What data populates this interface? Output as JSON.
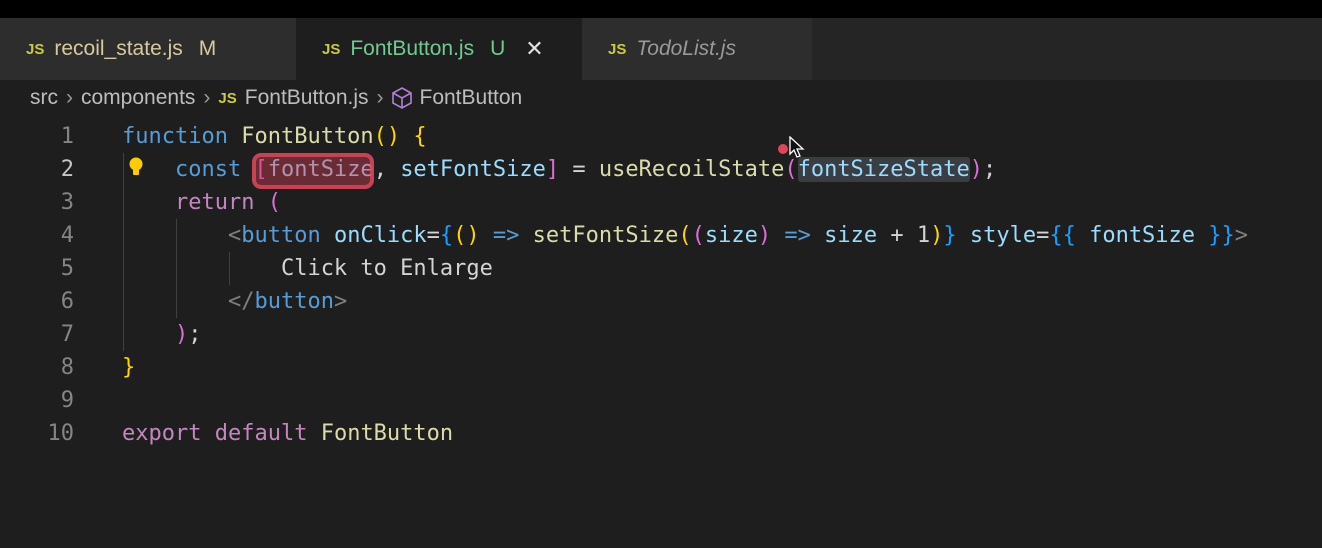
{
  "tabs": [
    {
      "label": "recoil_state.js",
      "badge": "M",
      "icon": "js-file-icon",
      "active": false
    },
    {
      "label": "FontButton.js",
      "badge": "U",
      "icon": "js-file-icon",
      "active": true
    },
    {
      "label": "TodoList.js",
      "badge": "",
      "icon": "js-file-icon",
      "active": false,
      "preview": true
    }
  ],
  "tab_icon_text": "JS",
  "breadcrumb": [
    "src",
    "components",
    "FontButton.js",
    "FontButton"
  ],
  "colors": {
    "accent_active_tab": "#73c991",
    "modified": "#d7c9a0",
    "highlight_box": "#d7465a"
  },
  "lines": [
    {
      "n": "1",
      "tokens": [
        [
          "function",
          "kw"
        ],
        [
          " ",
          ""
        ],
        [
          "FontButton",
          "fn"
        ],
        [
          "()",
          "b1"
        ],
        [
          " ",
          ""
        ],
        [
          "{",
          "b1"
        ]
      ]
    },
    {
      "n": "2",
      "tokens": [
        [
          "    ",
          ""
        ],
        [
          "const",
          "kw"
        ],
        [
          " ",
          ""
        ],
        [
          "[",
          "b2"
        ],
        [
          "fontSize",
          "var"
        ],
        [
          ", ",
          ""
        ],
        [
          "setFontSize",
          "var"
        ],
        [
          "]",
          "b2"
        ],
        [
          " = ",
          ""
        ],
        [
          "useRecoilState",
          "fn"
        ],
        [
          "(",
          "b2"
        ],
        [
          "fontSizeState",
          "var hl"
        ],
        [
          ")",
          "b2"
        ],
        [
          ";",
          ""
        ]
      ]
    },
    {
      "n": "3",
      "tokens": [
        [
          "    ",
          ""
        ],
        [
          "return",
          "ctl"
        ],
        [
          " ",
          ""
        ],
        [
          "(",
          "b2"
        ]
      ]
    },
    {
      "n": "4",
      "tokens": [
        [
          "        ",
          ""
        ],
        [
          "<",
          "tag"
        ],
        [
          "button",
          "kw"
        ],
        [
          " ",
          ""
        ],
        [
          "onClick",
          "var"
        ],
        [
          "=",
          ""
        ],
        [
          "{",
          "b3"
        ],
        [
          "()",
          "b1"
        ],
        [
          " ",
          ""
        ],
        [
          "=>",
          "kw"
        ],
        [
          " ",
          ""
        ],
        [
          "setFontSize",
          "fn"
        ],
        [
          "(",
          "b1"
        ],
        [
          "(",
          "b2"
        ],
        [
          "size",
          "var"
        ],
        [
          ")",
          "b2"
        ],
        [
          " ",
          ""
        ],
        [
          "=>",
          "kw"
        ],
        [
          " ",
          ""
        ],
        [
          "size",
          "var"
        ],
        [
          " + ",
          ""
        ],
        [
          "1",
          "txt"
        ],
        [
          ")",
          "b1"
        ],
        [
          "}",
          "b3"
        ],
        [
          " ",
          ""
        ],
        [
          "style",
          "var"
        ],
        [
          "=",
          ""
        ],
        [
          "{{",
          "b3"
        ],
        [
          " ",
          ""
        ],
        [
          "fontSize",
          "var"
        ],
        [
          " ",
          ""
        ],
        [
          "}}",
          "b3"
        ],
        [
          ">",
          "tag"
        ]
      ]
    },
    {
      "n": "5",
      "tokens": [
        [
          "            ",
          ""
        ],
        [
          "Click to Enlarge",
          "txt"
        ]
      ]
    },
    {
      "n": "6",
      "tokens": [
        [
          "        ",
          ""
        ],
        [
          "</",
          "tag"
        ],
        [
          "button",
          "kw"
        ],
        [
          ">",
          "tag"
        ]
      ]
    },
    {
      "n": "7",
      "tokens": [
        [
          "    ",
          ""
        ],
        [
          ")",
          "b2"
        ],
        [
          ";",
          ""
        ]
      ]
    },
    {
      "n": "8",
      "tokens": [
        [
          "}",
          "b1"
        ]
      ]
    },
    {
      "n": "9",
      "tokens": []
    },
    {
      "n": "10",
      "tokens": [
        [
          "export",
          "ctl"
        ],
        [
          " ",
          ""
        ],
        [
          "default",
          "ctl"
        ],
        [
          " ",
          ""
        ],
        [
          "FontButton",
          "fn"
        ]
      ]
    }
  ]
}
